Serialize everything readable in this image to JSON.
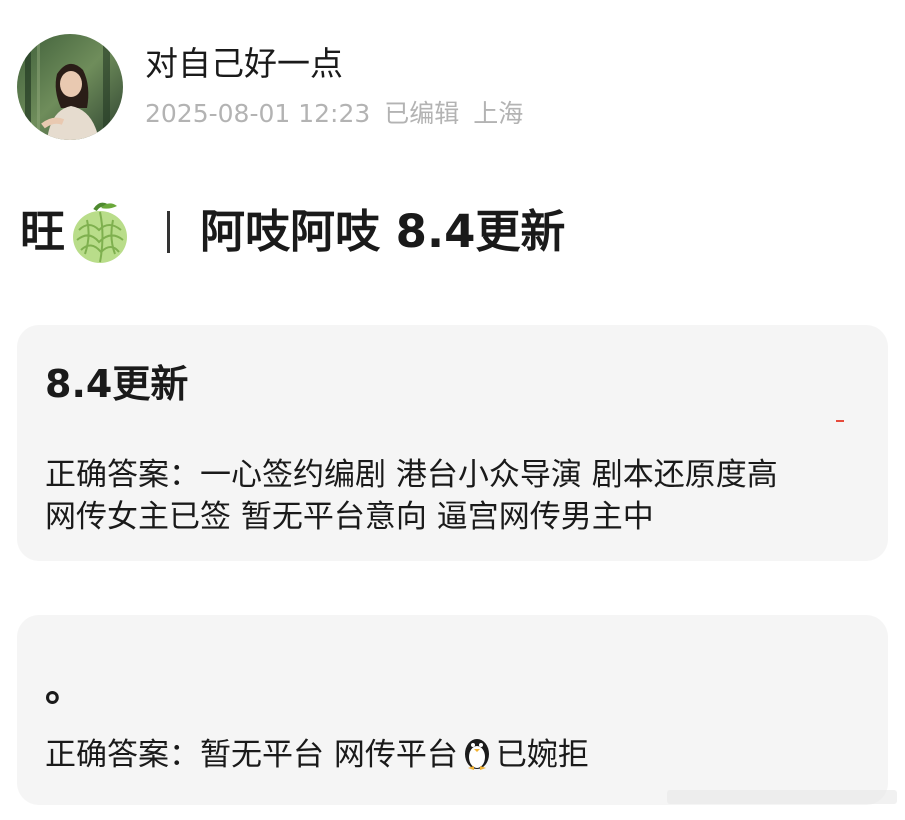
{
  "author": {
    "name": "对自己好一点",
    "timestamp": "2025-08-01 12:23",
    "edited_label": "已编辑",
    "location": "上海"
  },
  "post": {
    "title_prefix": "旺",
    "title_icon": "melon-icon",
    "title_main": "阿吱阿吱 8.4更新"
  },
  "cards": [
    {
      "heading": "8.4更新",
      "lines": [
        "正确答案：一心签约编剧 港台小众导演 剧本还原度高",
        "网传女主已签 暂无平台意向 逼宫网传男主中"
      ]
    },
    {
      "heading": "。",
      "text_before_icon": "正确答案：暂无平台 网传平台",
      "icon": "penguin-icon",
      "text_after_icon": "已婉拒"
    }
  ],
  "colors": {
    "card_bg": "#f5f5f5",
    "meta_text": "#b3b3b3",
    "accent_dash": "#e64a3b"
  }
}
